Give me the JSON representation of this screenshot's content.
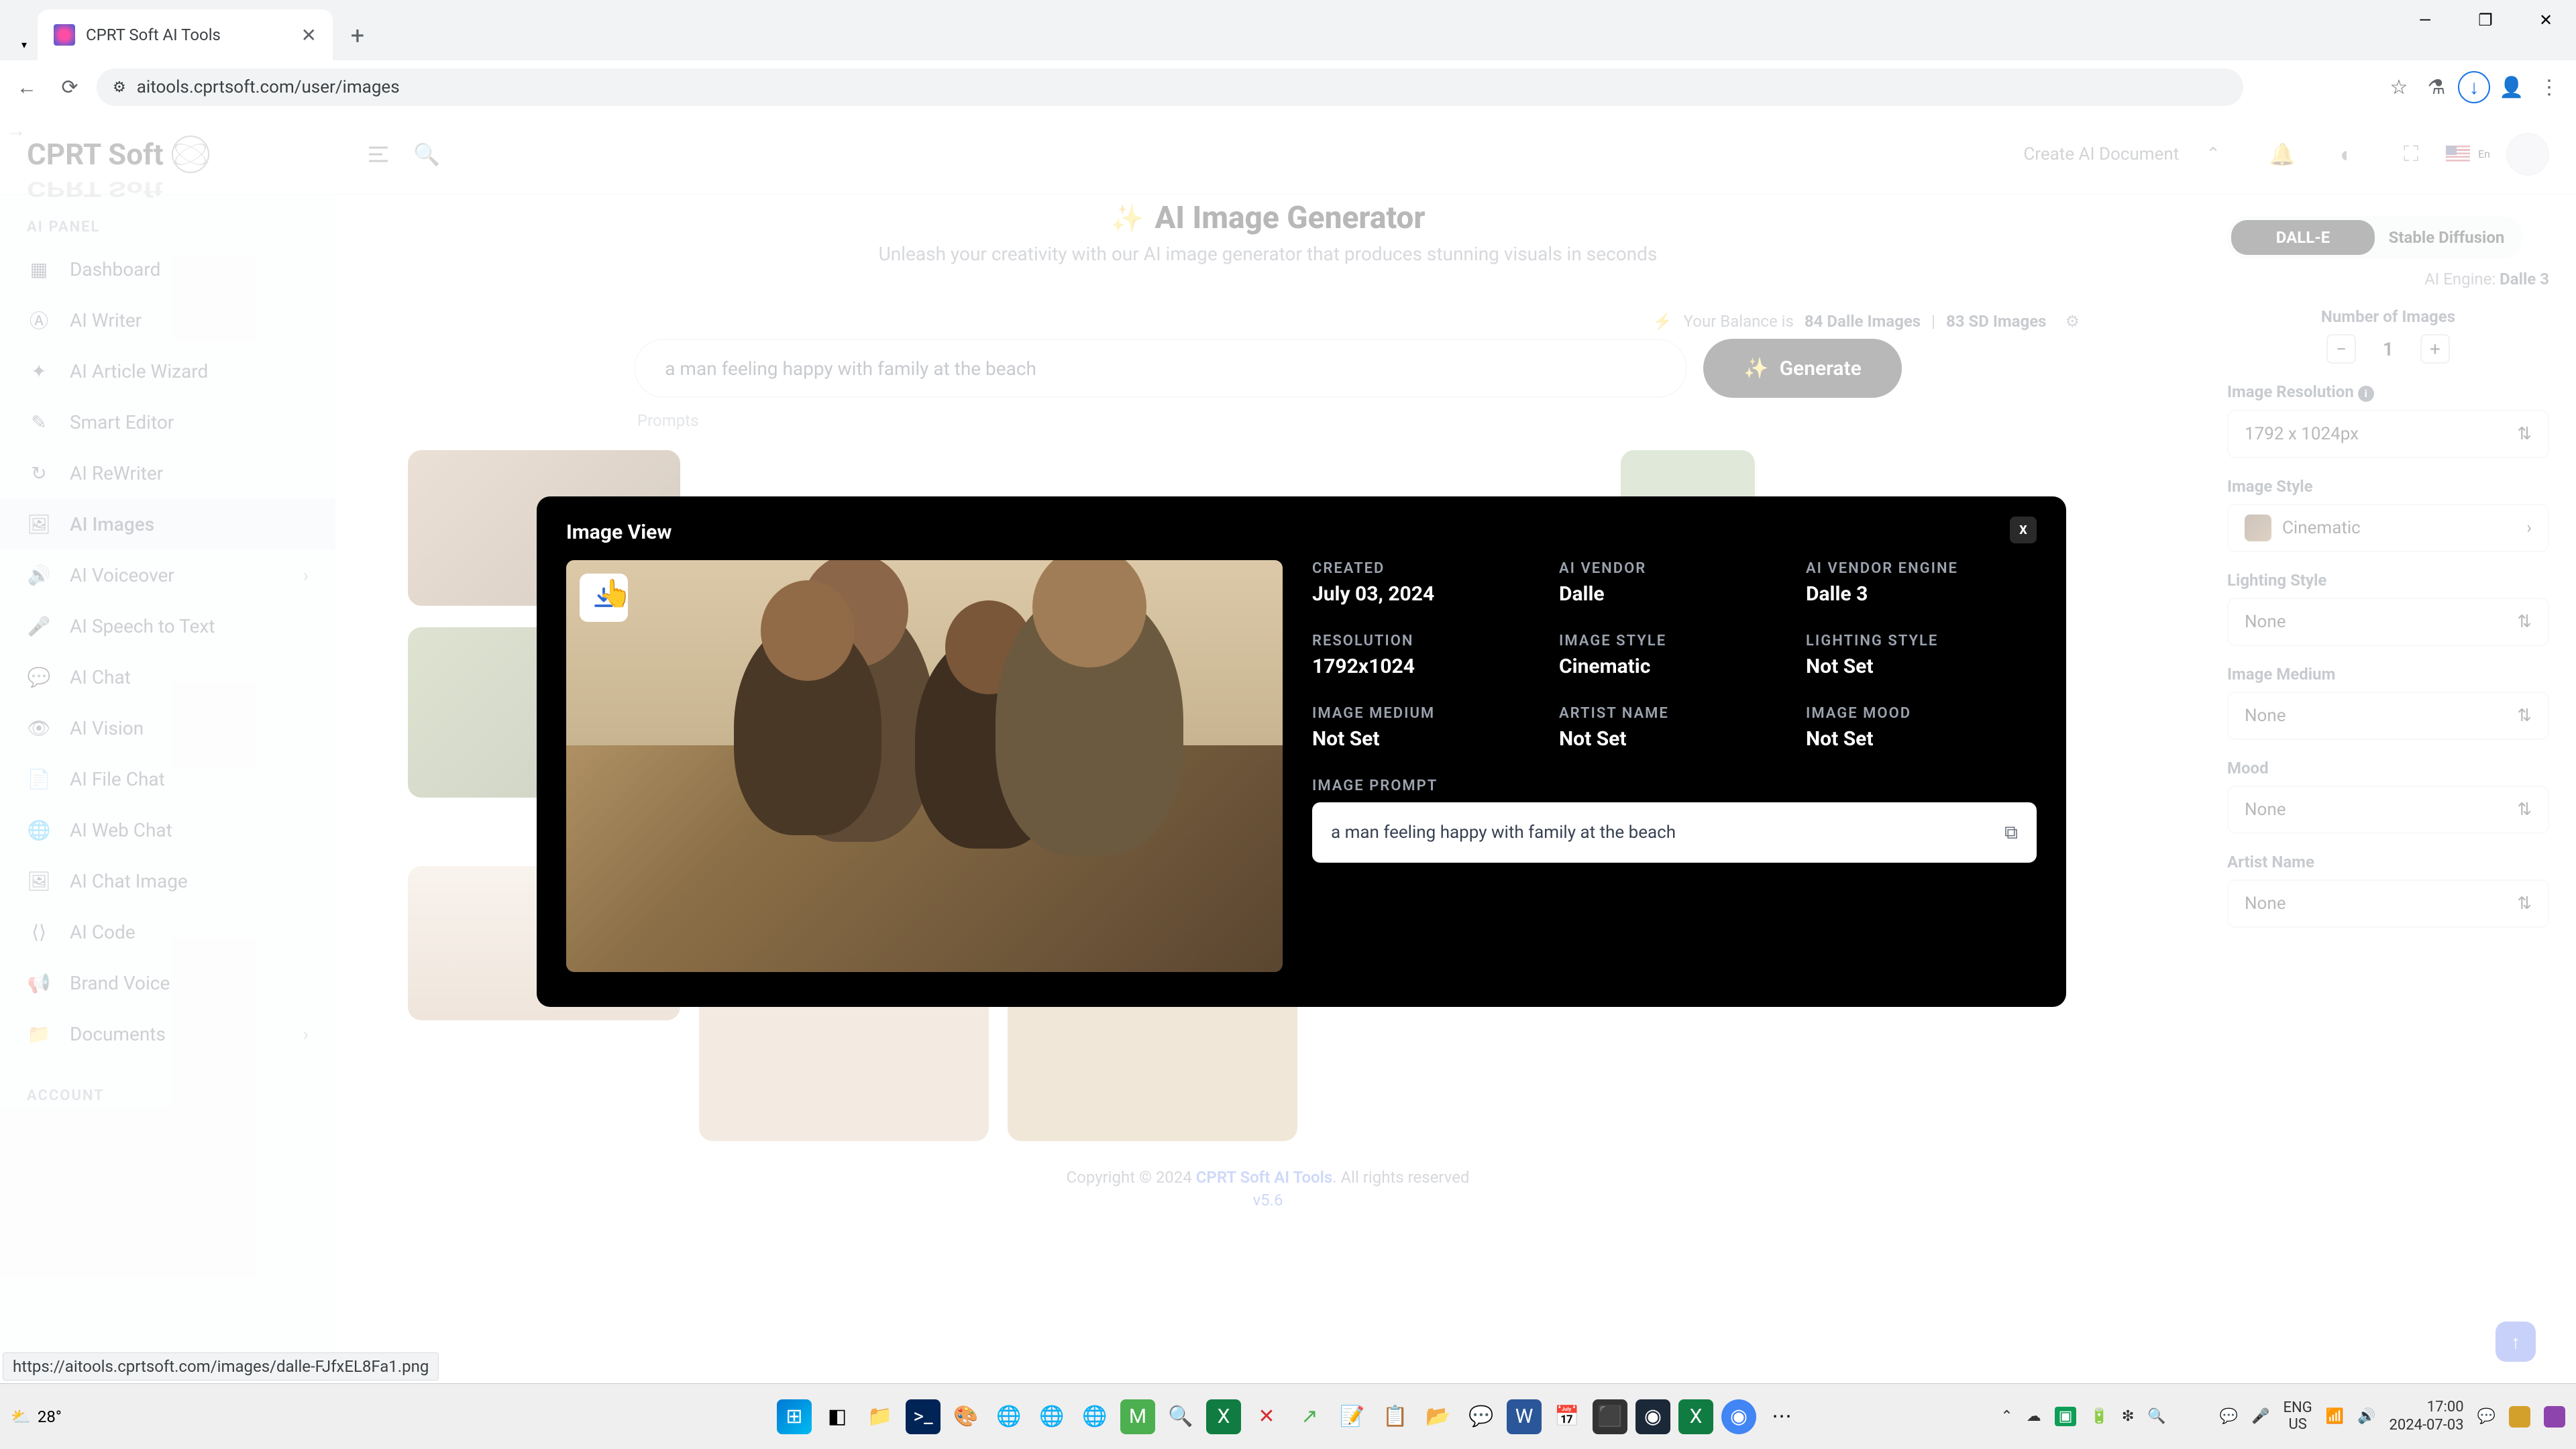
{
  "browser": {
    "tab_title": "CPRT Soft AI Tools",
    "url": "aitools.cprtsoft.com/user/images"
  },
  "header": {
    "logo_text": "CPRT Soft",
    "create_doc": "Create AI Document",
    "lang": "En"
  },
  "sidebar": {
    "section1": "AI PANEL",
    "section2": "ACCOUNT",
    "items": [
      {
        "label": "Dashboard"
      },
      {
        "label": "AI Writer"
      },
      {
        "label": "AI Article Wizard"
      },
      {
        "label": "Smart Editor"
      },
      {
        "label": "AI ReWriter"
      },
      {
        "label": "AI Images"
      },
      {
        "label": "AI Voiceover"
      },
      {
        "label": "AI Speech to Text"
      },
      {
        "label": "AI Chat"
      },
      {
        "label": "AI Vision"
      },
      {
        "label": "AI File Chat"
      },
      {
        "label": "AI Web Chat"
      },
      {
        "label": "AI Chat Image"
      },
      {
        "label": "AI Code"
      },
      {
        "label": "Brand Voice"
      },
      {
        "label": "Documents"
      }
    ]
  },
  "main": {
    "title": "AI Image Generator",
    "subtitle": "Unleash your creativity with our AI image generator that produces stunning visuals in seconds",
    "balance_prefix": "Your Balance is ",
    "balance_dalle": "84 Dalle Images",
    "balance_sep": " | ",
    "balance_sd": "83 SD Images",
    "prompt_value": "a man feeling happy with family at the beach",
    "generate": "Generate",
    "prompts_label": "Prompts"
  },
  "right_panel": {
    "opt1": "DALL-E",
    "opt2": "Stable Diffusion",
    "engine_label": "AI Engine: ",
    "engine_value": "Dalle 3",
    "num_images_label": "Number of Images",
    "num_images_value": "1",
    "resolution_label": "Image Resolution",
    "resolution_value": "1792 x 1024px",
    "style_label": "Image Style",
    "style_value": "Cinematic",
    "lighting_label": "Lighting Style",
    "lighting_value": "None",
    "medium_label": "Image Medium",
    "medium_value": "None",
    "mood_label": "Mood",
    "mood_value": "None",
    "artist_label": "Artist Name",
    "artist_value": "None"
  },
  "modal": {
    "title": "Image View",
    "fields": {
      "created_label": "CREATED",
      "created_value": "July 03, 2024",
      "vendor_label": "AI VENDOR",
      "vendor_value": "Dalle",
      "engine_label": "AI VENDOR ENGINE",
      "engine_value": "Dalle 3",
      "resolution_label": "RESOLUTION",
      "resolution_value": "1792x1024",
      "style_label": "IMAGE STYLE",
      "style_value": "Cinematic",
      "lighting_label": "LIGHTING STYLE",
      "lighting_value": "Not Set",
      "medium_label": "IMAGE MEDIUM",
      "medium_value": "Not Set",
      "artist_label": "ARTIST NAME",
      "artist_value": "Not Set",
      "mood_label": "IMAGE MOOD",
      "mood_value": "Not Set",
      "prompt_label": "IMAGE PROMPT",
      "prompt_value": "a man feeling happy with family at the beach"
    }
  },
  "footer": {
    "copyright_pre": "Copyright © 2024 ",
    "link": "CPRT Soft AI Tools",
    "copyright_post": ". All rights reserved",
    "version": "v5.6"
  },
  "status_link": "https://aitools.cprtsoft.com/images/dalle-FJfxEL8Fa1.png",
  "taskbar": {
    "temp": "28°",
    "lang1": "ENG",
    "lang2": "US",
    "time": "17:00",
    "date": "2024-07-03"
  }
}
